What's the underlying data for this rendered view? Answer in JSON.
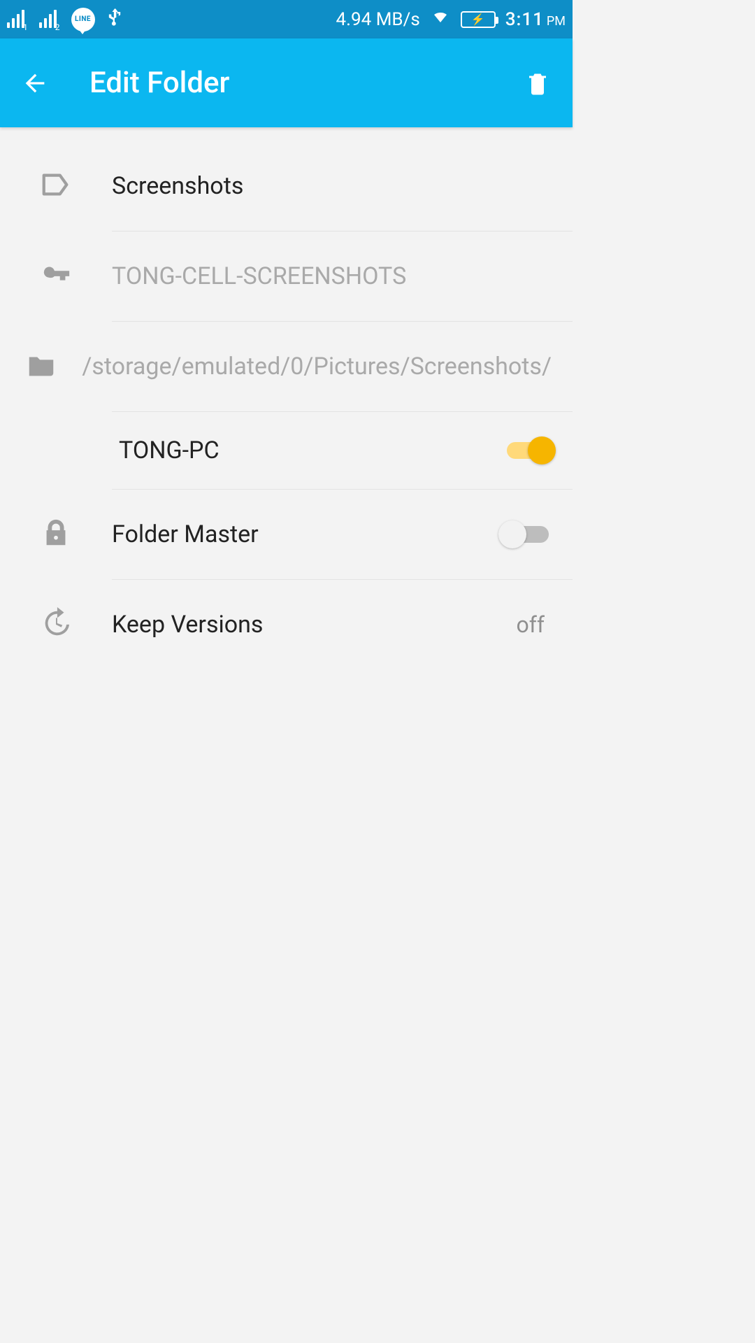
{
  "status": {
    "sim1_sub": "1",
    "sim2_sub": "2",
    "line_text": "LINE",
    "net_speed": "4.94 MB/s",
    "time": "3:11",
    "ampm": "PM"
  },
  "appbar": {
    "title": "Edit Folder"
  },
  "rows": {
    "label": {
      "text": "Screenshots"
    },
    "id": {
      "text": "TONG-CELL-SCREENSHOTS"
    },
    "path": {
      "text": "/storage/emulated/0/Pictures/Screenshots/"
    },
    "device": {
      "text": "TONG-PC",
      "on": true
    },
    "master": {
      "text": "Folder Master",
      "on": false
    },
    "versions": {
      "text": "Keep Versions",
      "value": "off"
    }
  }
}
